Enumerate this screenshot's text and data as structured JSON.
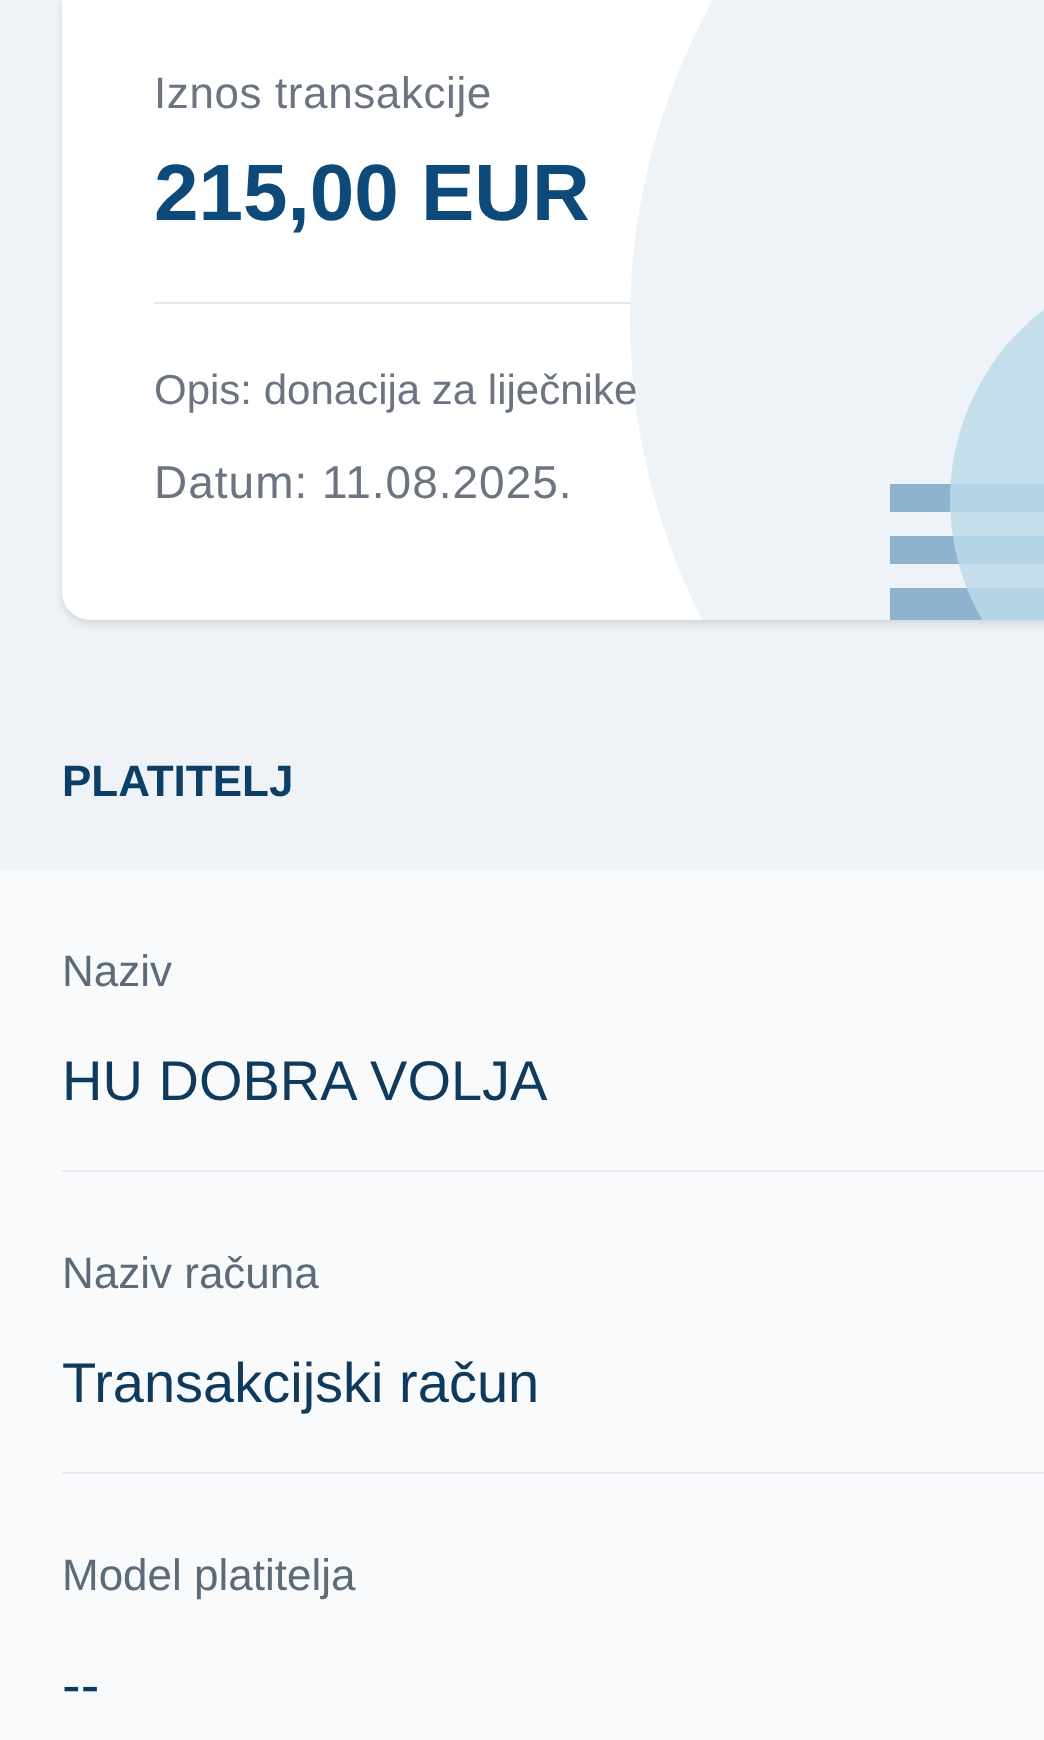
{
  "transaction_card": {
    "amount_label": "Iznos transakcije",
    "amount": "215,00 EUR",
    "description": "Opis: donacija za liječnike",
    "date": "Datum: 11.08.2025."
  },
  "payer_section": {
    "title": "PLATITELJ",
    "fields": [
      {
        "label": "Naziv",
        "value": "HU DOBRA VOLJA"
      },
      {
        "label": "Naziv računa",
        "value": "Transakcijski račun"
      },
      {
        "label": "Model platitelja",
        "value": "--"
      }
    ]
  }
}
